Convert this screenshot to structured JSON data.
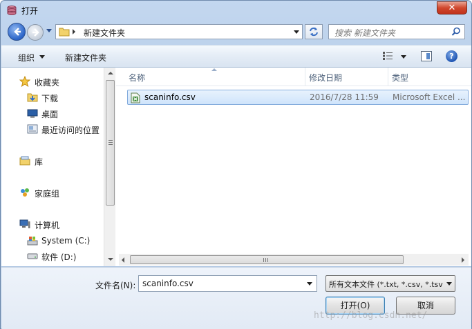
{
  "window": {
    "title": "打开",
    "close_label": "✕"
  },
  "nav": {
    "address_path": "新建文件夹",
    "search_placeholder": "搜索 新建文件夹"
  },
  "toolbar": {
    "organize_label": "组织",
    "new_folder_label": "新建文件夹",
    "help_label": "?"
  },
  "sidebar": {
    "items": [
      {
        "label": "收藏夹",
        "icon": "star-icon"
      },
      {
        "label": "下载",
        "icon": "downloads-folder-icon"
      },
      {
        "label": "桌面",
        "icon": "desktop-icon"
      },
      {
        "label": "最近访问的位置",
        "icon": "recent-places-icon"
      },
      {
        "label": "库",
        "icon": "libraries-icon"
      },
      {
        "label": "家庭组",
        "icon": "homegroup-icon"
      },
      {
        "label": "计算机",
        "icon": "computer-icon"
      },
      {
        "label": "System (C:)",
        "icon": "system-drive-icon"
      },
      {
        "label": "软件 (D:)",
        "icon": "drive-icon"
      }
    ]
  },
  "file_list": {
    "columns": [
      "名称",
      "修改日期",
      "类型"
    ],
    "rows": [
      {
        "name": "scaninfo.csv",
        "modified": "2016/7/28 11:59",
        "type": "Microsoft Excel ..."
      }
    ]
  },
  "bottom": {
    "filename_label": "文件名(N):",
    "filename_value": "scaninfo.csv",
    "filter_value": "所有文本文件 (*.txt, *.csv, *.tsv",
    "open_label": "打开(O)",
    "cancel_label": "取消"
  },
  "watermark": "http://blog.csdn.net/"
}
